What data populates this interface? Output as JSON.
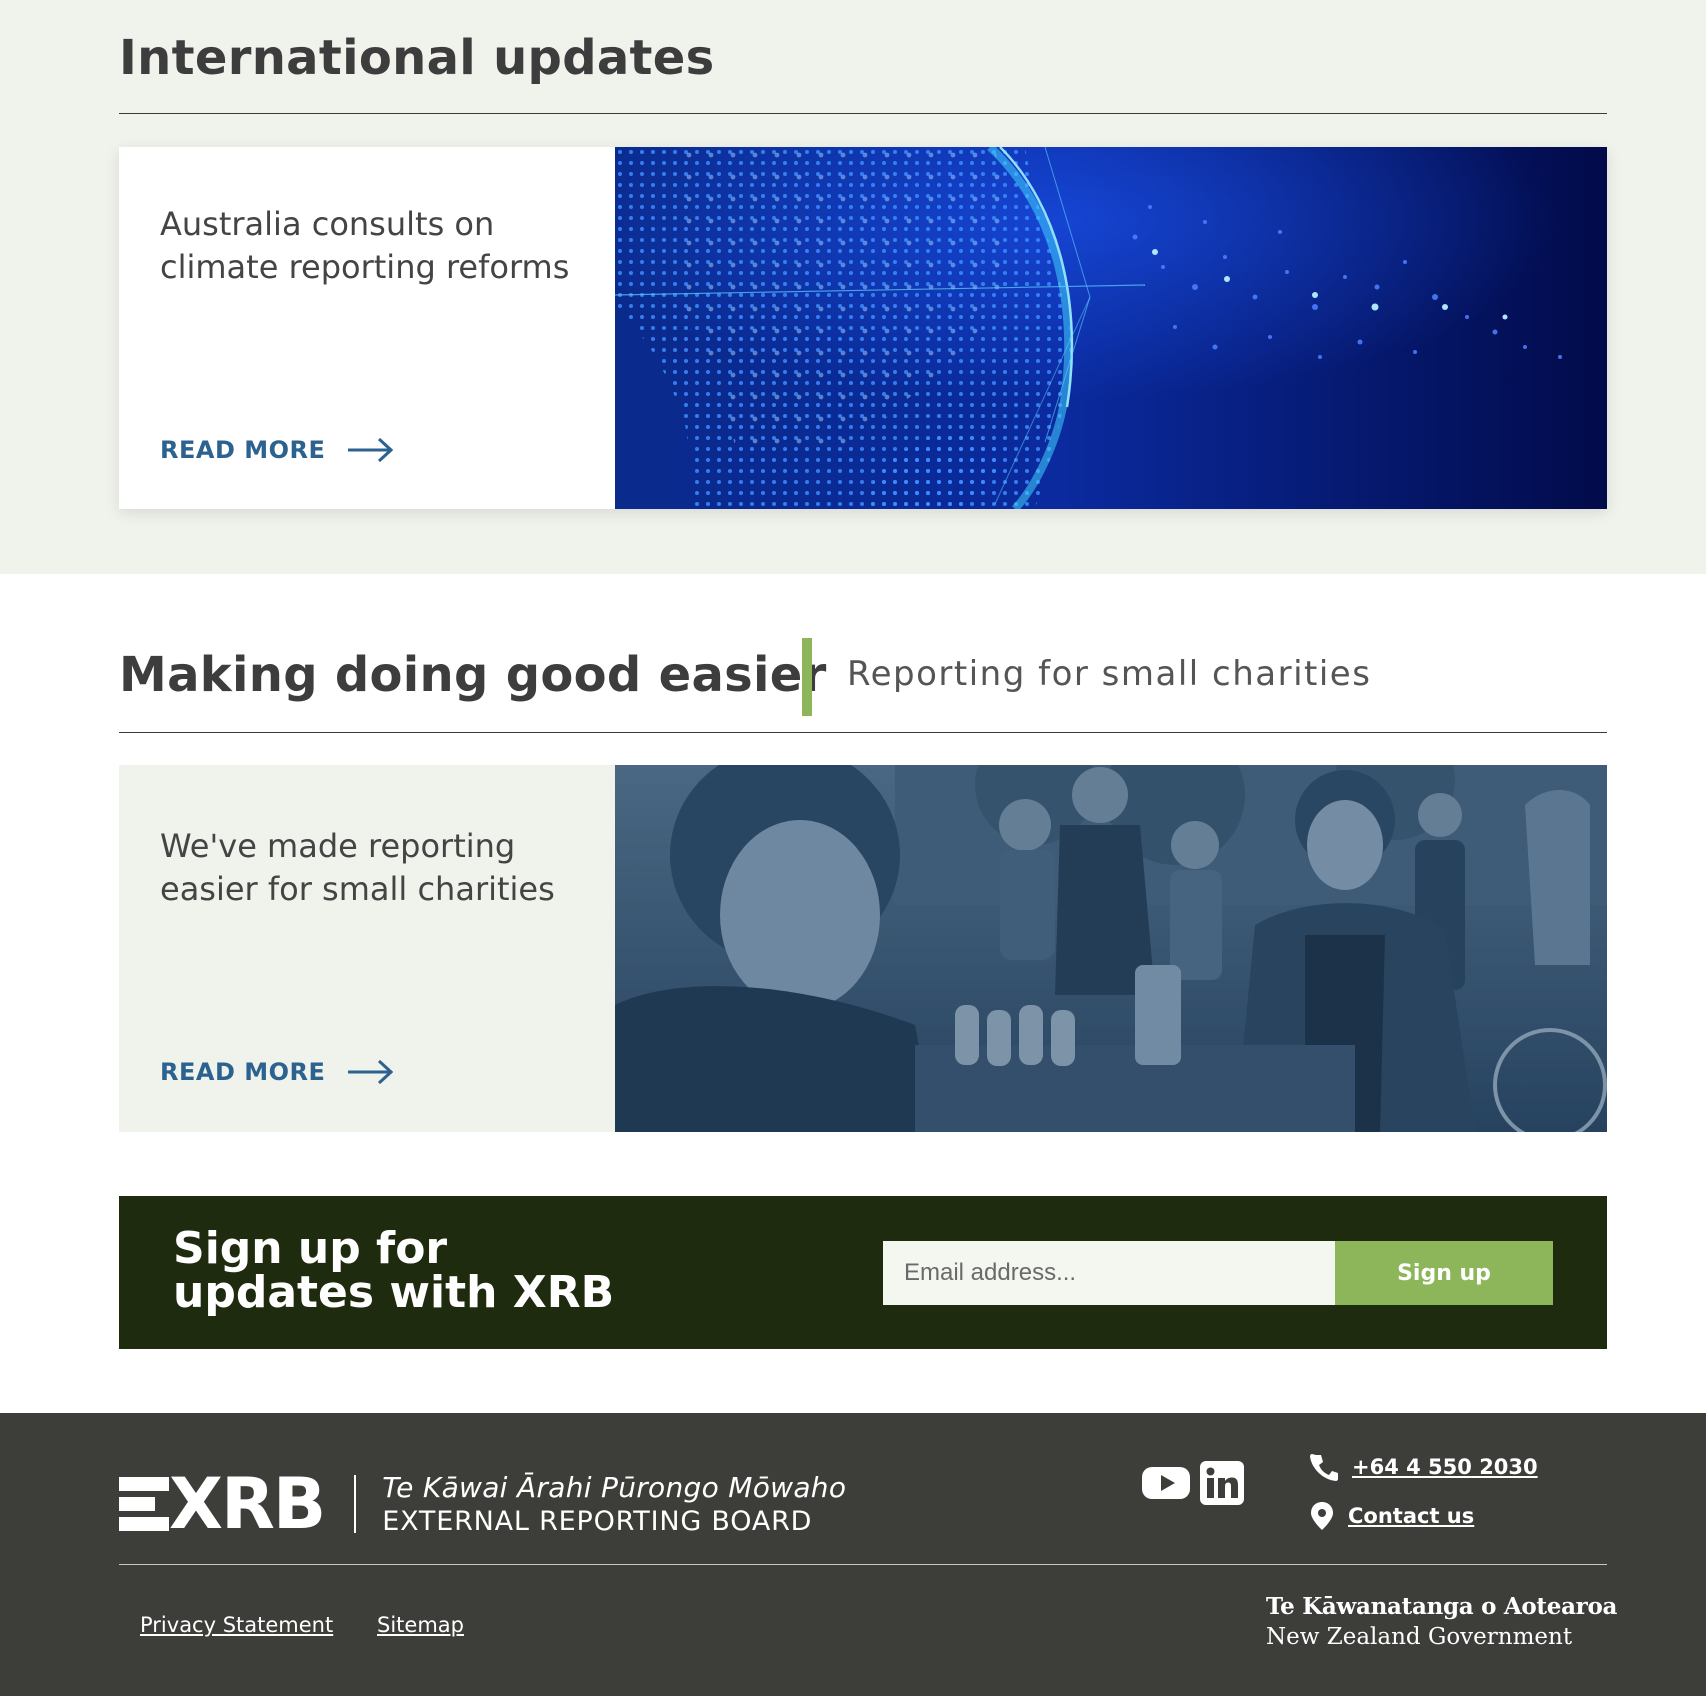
{
  "international": {
    "title": "International updates",
    "card": {
      "heading": "Australia consults on climate reporting reforms",
      "read_more": "READ MORE",
      "image": "digital-globe-dotted-map"
    }
  },
  "charities": {
    "title": "Making doing good easier",
    "subtitle": "Reporting for small charities",
    "card": {
      "heading": "We've made reporting easier for small charities",
      "read_more": "READ MORE",
      "image": "community-volunteers-photo"
    }
  },
  "signup": {
    "title": "Sign up for updates with XRB",
    "email_placeholder": "Email address...",
    "email_value": "",
    "button_label": "Sign up"
  },
  "footer": {
    "logo": {
      "mark": "XRB",
      "maori": "Te Kāwai Ārahi Pūrongo Mōwaho",
      "english": "EXTERNAL REPORTING BOARD"
    },
    "social": [
      "youtube-icon",
      "linkedin-icon"
    ],
    "phone": "+64 4 550 2030",
    "contact_label": "Contact us",
    "links": {
      "privacy": "Privacy Statement ",
      "sitemap": "Sitemap"
    },
    "govt": {
      "maori": "Te Kāwanatanga o Aotearoa",
      "english": "New Zealand Government"
    }
  },
  "colors": {
    "section_bg": "#f0f2ec",
    "link_blue": "#2c6290",
    "accent_green": "#8db55a",
    "signup_bg": "#1f2b0e",
    "footer_bg": "#3d3e3a"
  }
}
